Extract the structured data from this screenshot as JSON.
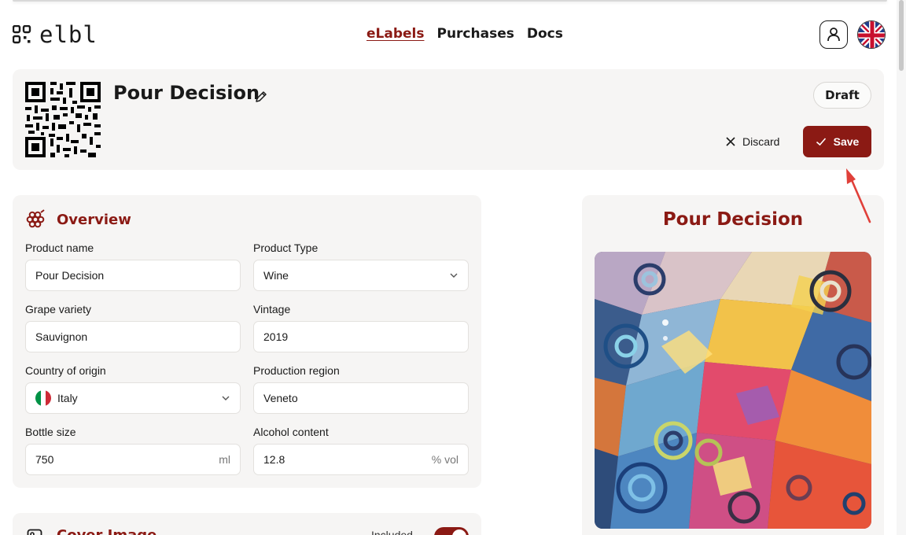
{
  "header": {
    "logo_text": "elbl",
    "nav": [
      {
        "label": "eLabels",
        "active": true
      },
      {
        "label": "Purchases",
        "active": false
      },
      {
        "label": "Docs",
        "active": false
      }
    ],
    "user_icon": "user-icon",
    "language_flag": "uk-flag-icon"
  },
  "product_header": {
    "title": "Pour Decision",
    "status_badge": "Draft",
    "discard_label": "Discard",
    "save_label": "Save"
  },
  "overview": {
    "title": "Overview",
    "fields": {
      "product_name": {
        "label": "Product name",
        "value": "Pour Decision"
      },
      "product_type": {
        "label": "Product Type",
        "value": "Wine"
      },
      "grape_variety": {
        "label": "Grape variety",
        "value": "Sauvignon"
      },
      "vintage": {
        "label": "Vintage",
        "value": "2019"
      },
      "country": {
        "label": "Country of origin",
        "value": "Italy"
      },
      "region": {
        "label": "Production region",
        "value": "Veneto"
      },
      "bottle_size": {
        "label": "Bottle size",
        "value": "750",
        "unit": "ml"
      },
      "alcohol": {
        "label": "Alcohol content",
        "value": "12.8",
        "unit": "% vol"
      }
    }
  },
  "cover_image": {
    "title": "Cover Image",
    "included_label": "Included",
    "included": true
  },
  "preview": {
    "title": "Pour Decision"
  },
  "colors": {
    "accent": "#8b1a14",
    "card_bg": "#f6f5f4",
    "annotation_arrow": "#e0403a"
  }
}
